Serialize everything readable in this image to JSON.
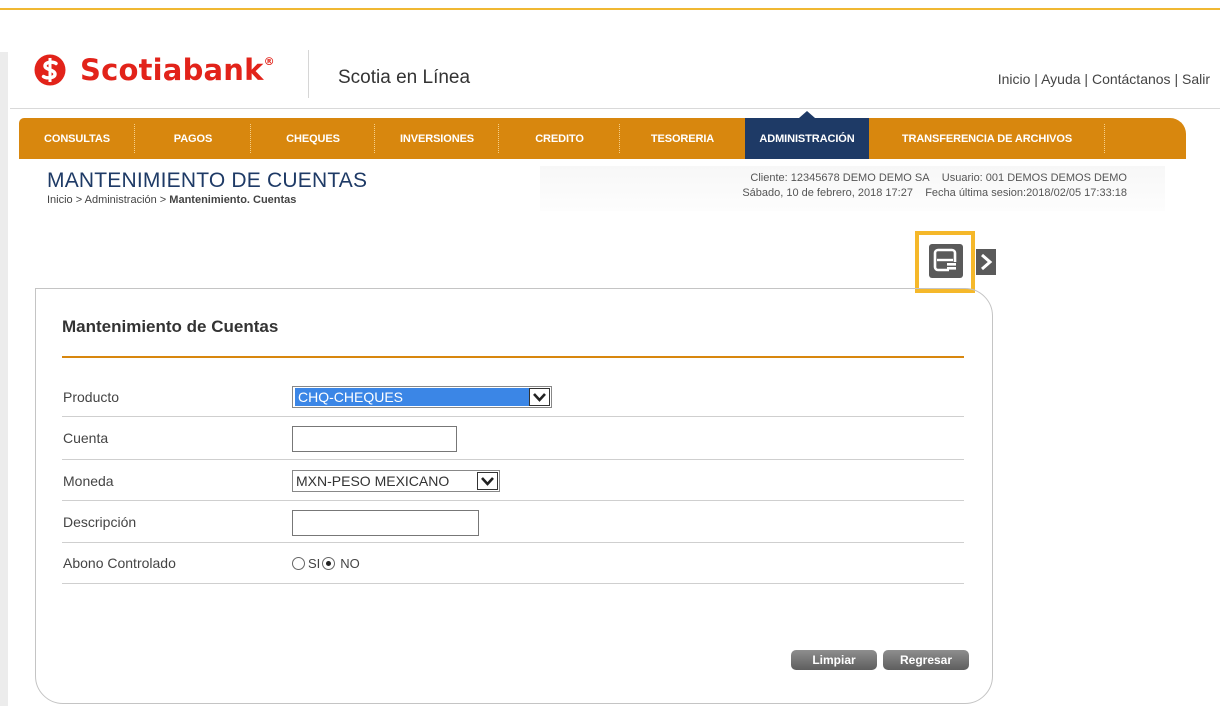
{
  "brand": {
    "logo_text": "Scotiabank",
    "registered_mark": "®",
    "product_name": "Scotia en Línea",
    "accent_color": "#e2231a",
    "highlight_color": "#f5b82a"
  },
  "top_links": {
    "home": "Inicio",
    "help": "Ayuda",
    "contact": "Contáctanos",
    "exit": "Salir",
    "separator": " | "
  },
  "nav": {
    "color": "#d8870e",
    "active_color": "#1e3a66",
    "items": [
      {
        "label": "CONSULTAS"
      },
      {
        "label": "PAGOS"
      },
      {
        "label": "CHEQUES"
      },
      {
        "label": "INVERSIONES"
      },
      {
        "label": "CREDITO"
      },
      {
        "label": "TESORERIA"
      },
      {
        "label": "ADMINISTRACIÓN",
        "active": true
      },
      {
        "label": "TRANSFERENCIA DE ARCHIVOS"
      }
    ]
  },
  "page": {
    "title": "MANTENIMIENTO DE CUENTAS",
    "breadcrumb_prefix": "Inicio > Administración > ",
    "breadcrumb_current": "Mantenimiento. Cuentas"
  },
  "session": {
    "client": "Cliente: 12345678 DEMO DEMO SA",
    "user": "Usuario: 001 DEMOS DEMOS DEMO",
    "date": "Sábado, 10 de febrero, 2018 17:27",
    "last_session": "Fecha última sesion:2018/02/05 17:33:18"
  },
  "toolbar": {
    "icons": [
      "print-icon",
      "chevron-right-icon"
    ]
  },
  "form": {
    "title": "Mantenimiento de Cuentas",
    "producto_label": "Producto",
    "producto_value": "CHQ-CHEQUES",
    "cuenta_label": "Cuenta",
    "cuenta_value": "",
    "moneda_label": "Moneda",
    "moneda_value": "MXN-PESO MEXICANO",
    "descripcion_label": "Descripción",
    "descripcion_value": "",
    "abono_label": "Abono Controlado",
    "abono_options": [
      {
        "label": "SI",
        "checked": false
      },
      {
        "label": "NO",
        "checked": true
      }
    ]
  },
  "buttons": {
    "clear": "Limpiar",
    "back": "Regresar"
  }
}
